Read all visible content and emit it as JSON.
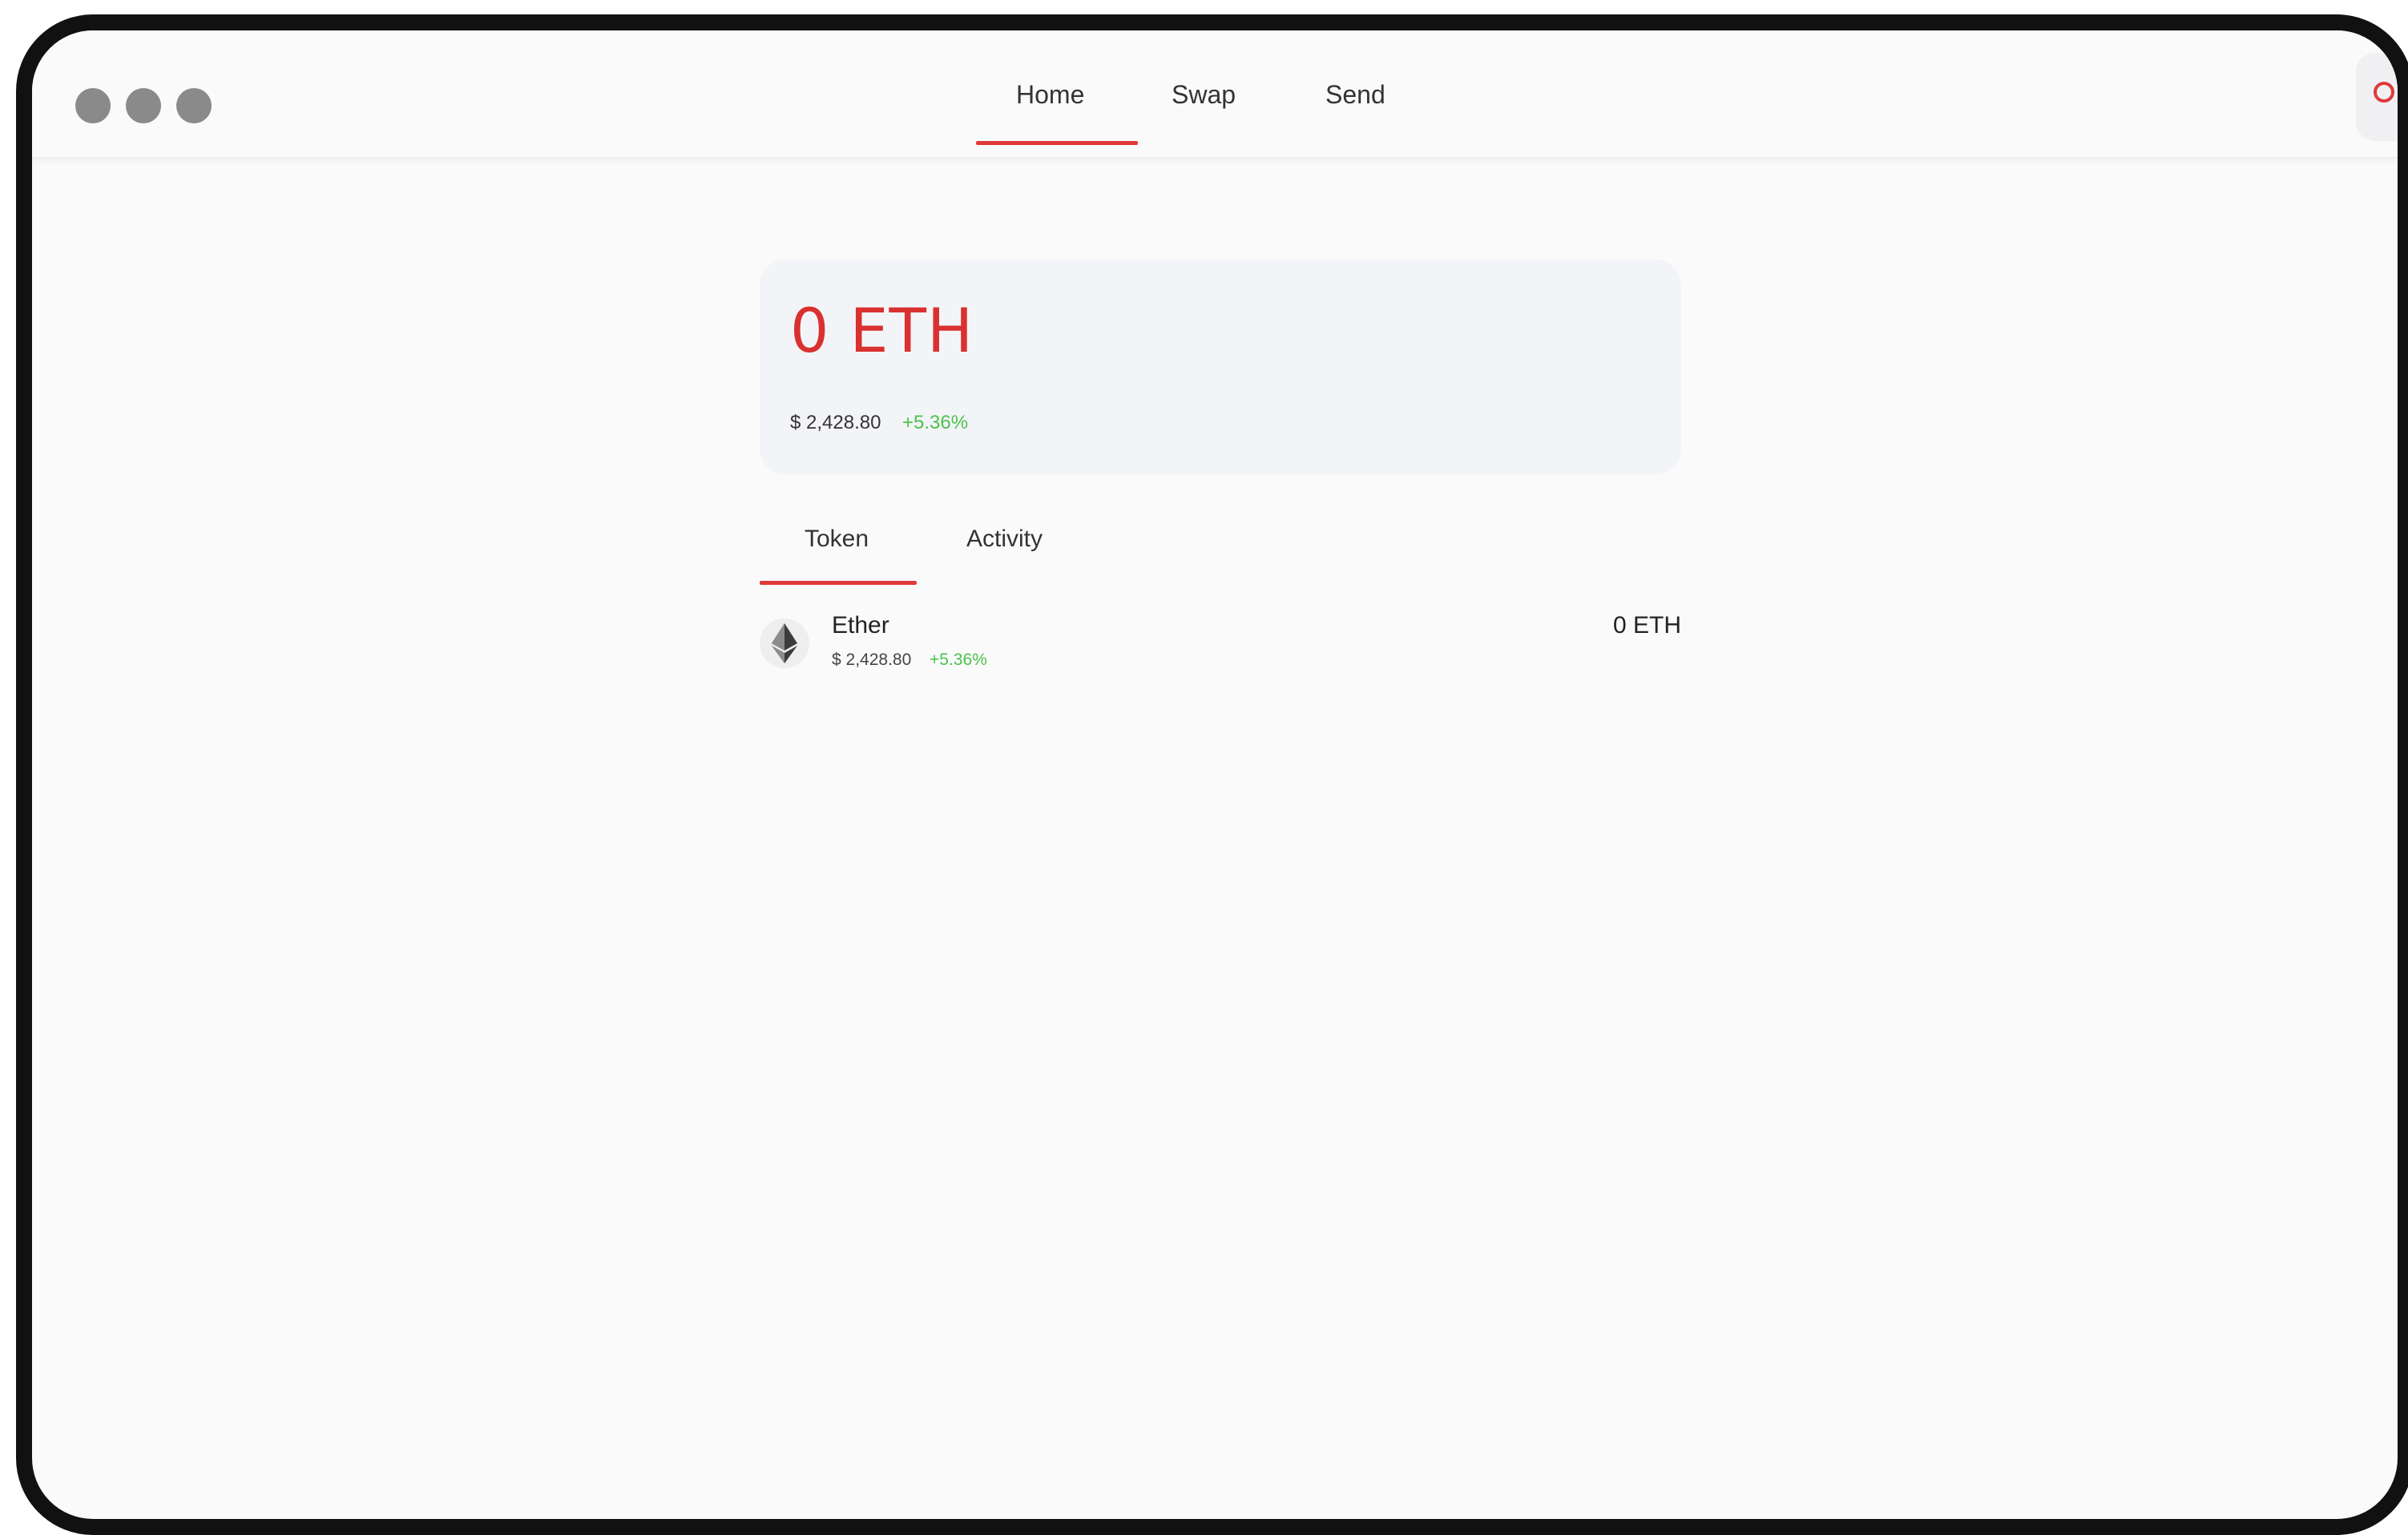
{
  "nav": {
    "tabs": [
      {
        "label": "Home",
        "active": true
      },
      {
        "label": "Swap",
        "active": false
      },
      {
        "label": "Send",
        "active": false
      }
    ]
  },
  "balance": {
    "amount": "0 ETH",
    "fiat": "$ 2,428.80",
    "change": "+5.36%"
  },
  "content_tabs": [
    {
      "label": "Token",
      "active": true
    },
    {
      "label": "Activity",
      "active": false
    }
  ],
  "tokens": [
    {
      "icon": "ethereum-icon",
      "name": "Ether",
      "fiat": "$ 2,428.80",
      "change": "+5.36%",
      "balance": "0 ETH"
    }
  ],
  "colors": {
    "accent": "#e03a3a",
    "amount_text": "#d93030",
    "positive_change": "#4cc24c",
    "window_controls": "#8a8a8a"
  }
}
